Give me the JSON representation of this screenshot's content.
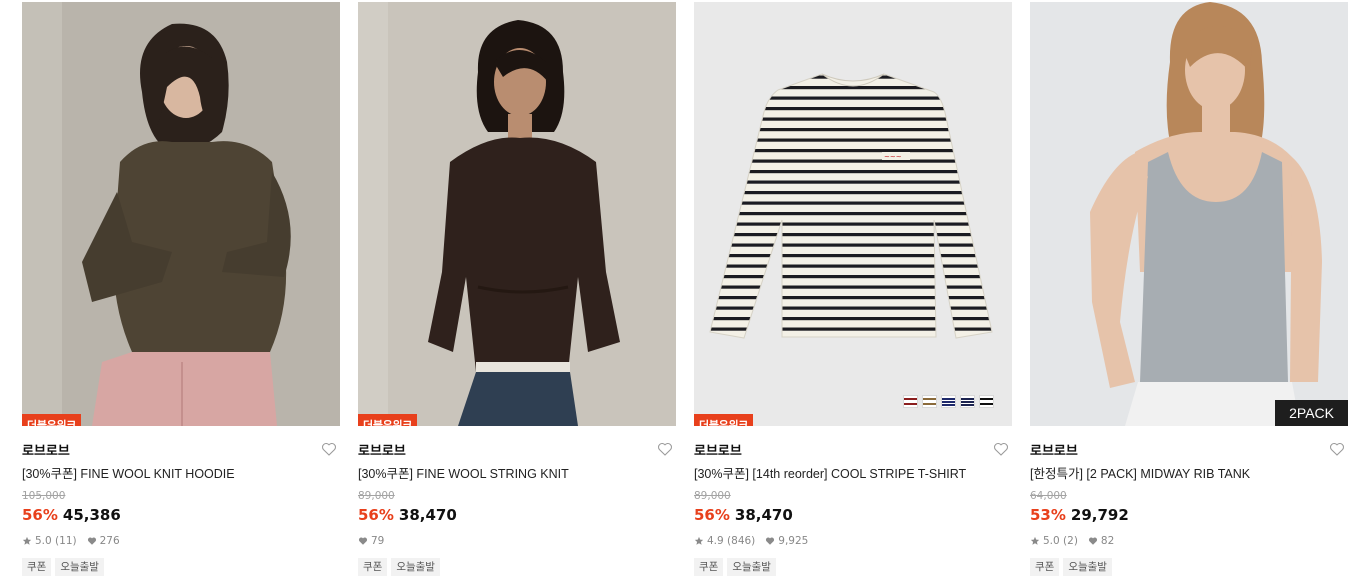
{
  "products": [
    {
      "badge": "더블유위크",
      "brand": "로브로브",
      "name": "[30%쿠폰] FINE WOOL KNIT HOODIE",
      "original_price": "105,000",
      "discount": "56%",
      "price": "45,386",
      "rating": "5.0 (11)",
      "likes": "276",
      "tags": [
        "쿠폰",
        "오늘출발"
      ]
    },
    {
      "badge": "더블유위크",
      "brand": "로브로브",
      "name": "[30%쿠폰] FINE WOOL STRING KNIT",
      "original_price": "89,000",
      "discount": "56%",
      "price": "38,470",
      "likes": "79",
      "tags": [
        "쿠폰",
        "오늘출발"
      ]
    },
    {
      "badge": "더블유위크",
      "brand": "로브로브",
      "name": "[30%쿠폰] [14th reorder] COOL STRIPE T-SHIRT",
      "original_price": "89,000",
      "discount": "56%",
      "price": "38,470",
      "rating": "4.9 (846)",
      "likes": "9,925",
      "tags": [
        "쿠폰",
        "오늘출발"
      ],
      "swatch_colors": [
        "#8b1e1e",
        "#8a6a3a",
        "#1f2a6b",
        "#1c2450",
        "#111111"
      ]
    },
    {
      "corner_badge": "2PACK",
      "brand": "로브로브",
      "name": "[한정특가] [2 PACK] MIDWAY RIB TANK",
      "original_price": "64,000",
      "discount": "53%",
      "price": "29,792",
      "rating": "5.0 (2)",
      "likes": "82",
      "tags": [
        "쿠폰",
        "오늘출발"
      ]
    }
  ],
  "colors": {
    "accent": "#e8401c",
    "muted": "#888888"
  },
  "icons": {
    "wishlist": "heart-outline-icon",
    "rating": "star-icon",
    "likes": "heart-filled-icon"
  }
}
